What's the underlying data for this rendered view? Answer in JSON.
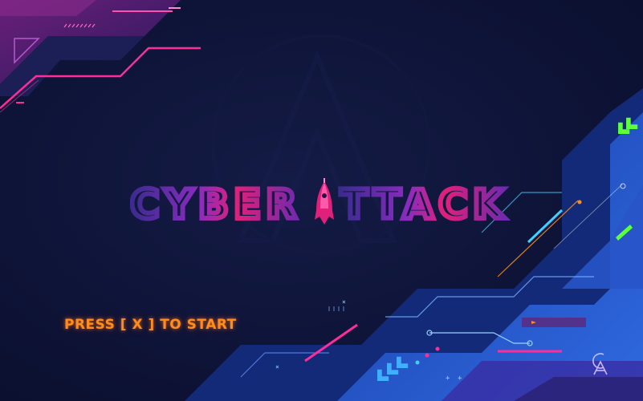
{
  "game": {
    "title": "CYBERATTACK",
    "title_left": "CYBER",
    "title_right": "TTACK",
    "start_prompt": "PRESS [ X ] TO START",
    "logo_initials": "CA"
  },
  "colors": {
    "background": "#0f1538",
    "accent_pink": "#ff2d9a",
    "accent_blue": "#1e5bd8",
    "accent_cyan": "#3fd0ff",
    "accent_green": "#5dff3a",
    "accent_orange": "#ff8c1f",
    "title_purple": "#8a2bbf"
  },
  "icons": [
    "rocket-icon",
    "chevron-arrows-icon",
    "ca-monogram-icon"
  ]
}
